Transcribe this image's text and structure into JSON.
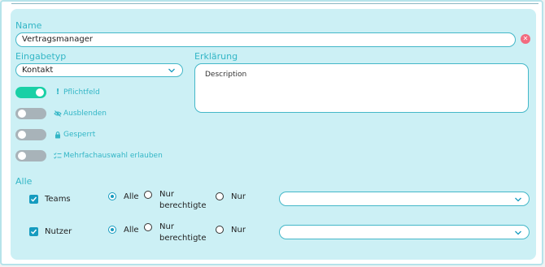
{
  "form": {
    "name_label": "Name",
    "name_value": "Vertragsmanager",
    "type_label": "Eingabetyp",
    "type_value": "Kontakt",
    "description_label": "Erklärung",
    "description_placeholder": "Description",
    "options": [
      {
        "label": "Pflichtfeld",
        "on": true,
        "icon": "exclamation-icon"
      },
      {
        "label": "Ausblenden",
        "on": false,
        "icon": "eye-off-icon"
      },
      {
        "label": "Gesperrt",
        "on": false,
        "icon": "lock-icon"
      },
      {
        "label": "Mehrfachauswahl erlauben",
        "on": false,
        "icon": "checklist-icon"
      }
    ],
    "visibility_label": "Alle",
    "rows": [
      {
        "label": "Teams",
        "checked": true,
        "radio_all": "Alle",
        "radio_auth_1": "Nur",
        "radio_auth_2": "berechtigte",
        "radio_only": "Nur",
        "selected": "Alle"
      },
      {
        "label": "Nutzer",
        "checked": true,
        "radio_all": "Alle",
        "radio_auth_1": "Nur",
        "radio_auth_2": "berechtigte",
        "radio_only": "Nur",
        "selected": "Alle"
      }
    ]
  },
  "colors": {
    "accent": "#33b6c6",
    "toggle_on": "#19d0a6",
    "toggle_off": "#a8b3b9",
    "checkbox": "#169bbf",
    "panel": "#ccf0f5",
    "clear": "#f36b7f"
  }
}
